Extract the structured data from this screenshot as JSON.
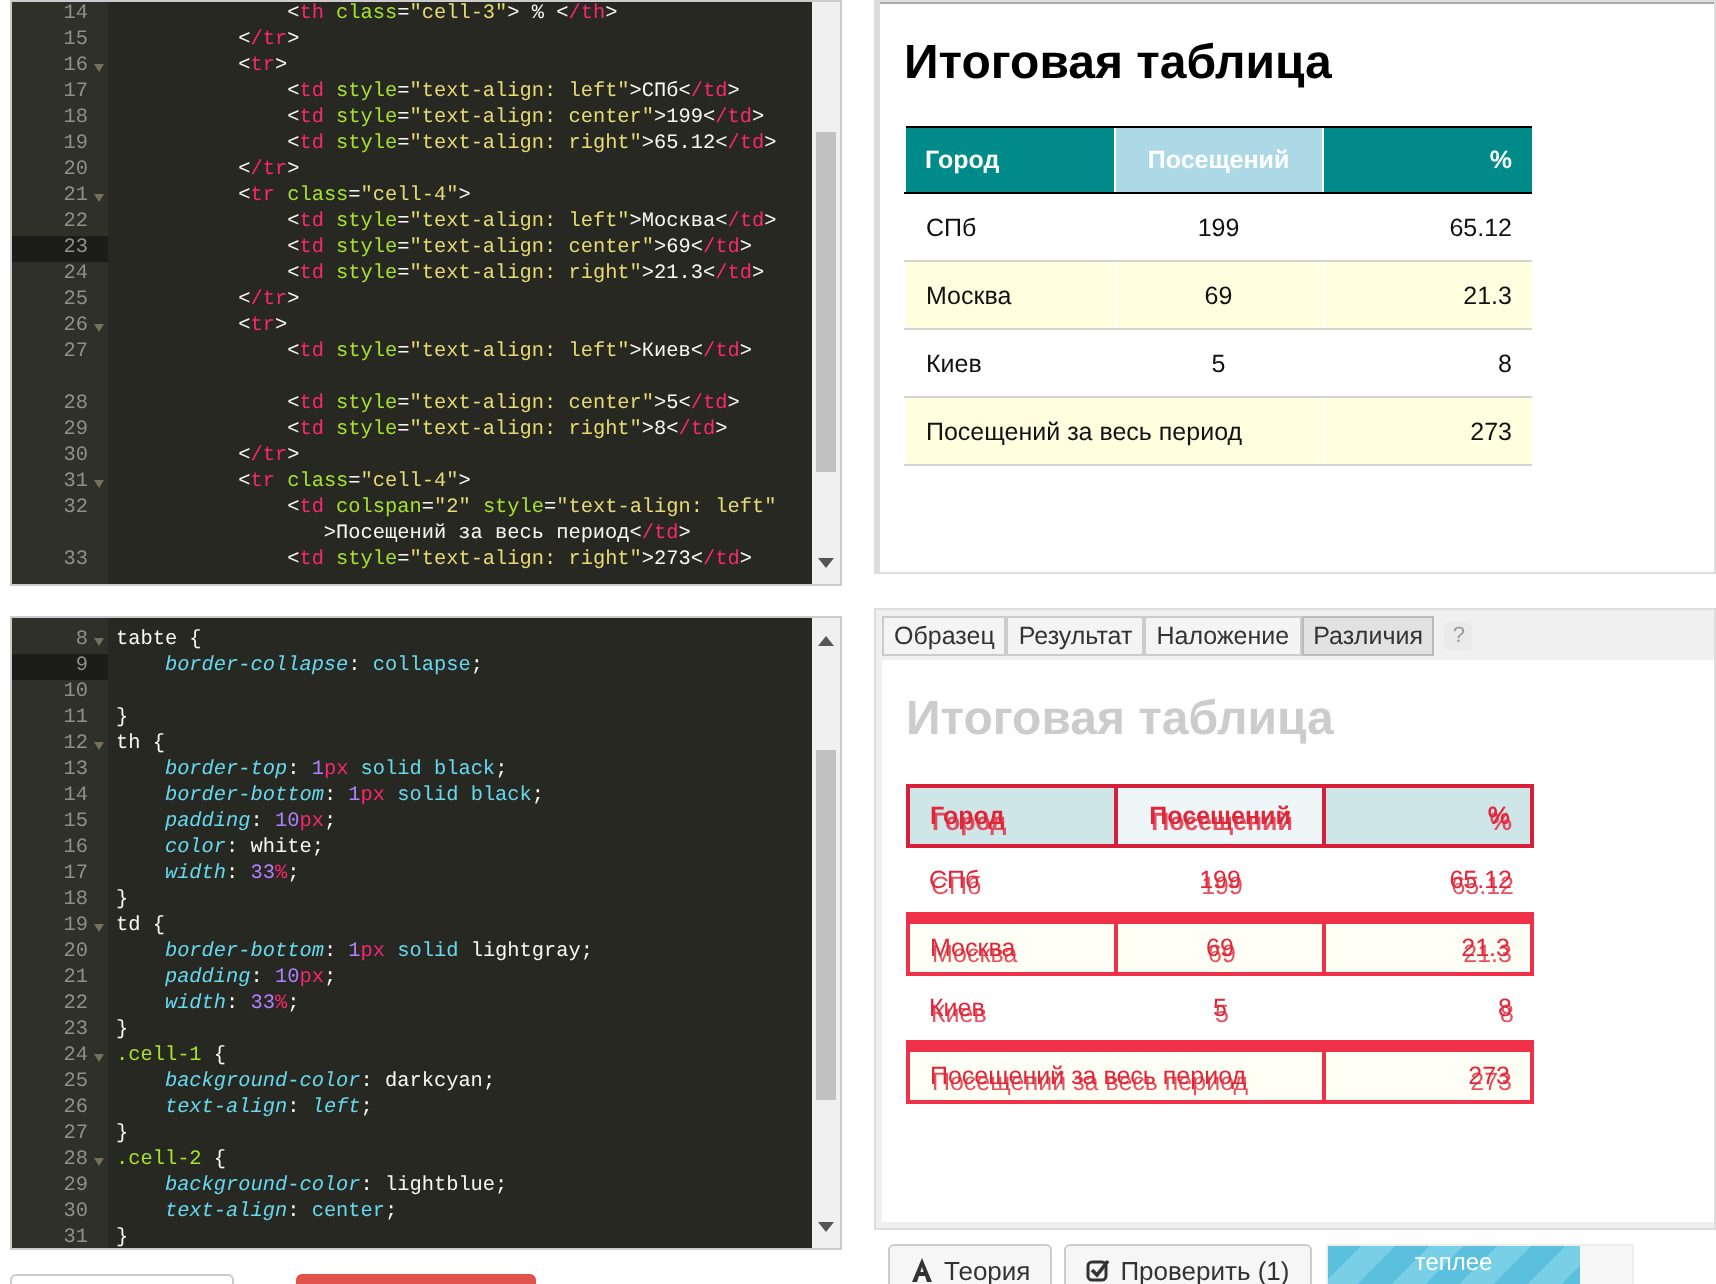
{
  "html_editor": {
    "lines": [
      {
        "number": "14",
        "fold": false,
        "current": false,
        "tokens": [
          {
            "kind": "punct",
            "text": "              <"
          },
          {
            "kind": "tag",
            "text": "th"
          },
          {
            "kind": "attr",
            "text": " class"
          },
          {
            "kind": "punct",
            "text": "="
          },
          {
            "kind": "str",
            "text": "\"cell-3\""
          },
          {
            "kind": "punct",
            "text": "> % <"
          },
          {
            "kind": "tag",
            "text": "/th"
          },
          {
            "kind": "punct",
            "text": ">"
          }
        ]
      },
      {
        "number": "15",
        "fold": false,
        "current": false,
        "tokens": [
          {
            "kind": "punct",
            "text": "          <"
          },
          {
            "kind": "tag",
            "text": "/tr"
          },
          {
            "kind": "punct",
            "text": ">"
          }
        ]
      },
      {
        "number": "16",
        "fold": true,
        "current": false,
        "tokens": [
          {
            "kind": "punct",
            "text": "          <"
          },
          {
            "kind": "tag",
            "text": "tr"
          },
          {
            "kind": "punct",
            "text": ">"
          }
        ]
      },
      {
        "number": "17",
        "fold": false,
        "current": false,
        "tokens": [
          {
            "kind": "punct",
            "text": "              <"
          },
          {
            "kind": "tag",
            "text": "td"
          },
          {
            "kind": "attr",
            "text": " style"
          },
          {
            "kind": "punct",
            "text": "="
          },
          {
            "kind": "str",
            "text": "\"text-align: left\""
          },
          {
            "kind": "punct",
            "text": ">СПб<"
          },
          {
            "kind": "tag",
            "text": "/td"
          },
          {
            "kind": "punct",
            "text": ">"
          }
        ]
      },
      {
        "number": "18",
        "fold": false,
        "current": false,
        "tokens": [
          {
            "kind": "punct",
            "text": "              <"
          },
          {
            "kind": "tag",
            "text": "td"
          },
          {
            "kind": "attr",
            "text": " style"
          },
          {
            "kind": "punct",
            "text": "="
          },
          {
            "kind": "str",
            "text": "\"text-align: center\""
          },
          {
            "kind": "punct",
            "text": ">199<"
          },
          {
            "kind": "tag",
            "text": "/td"
          },
          {
            "kind": "punct",
            "text": ">"
          }
        ]
      },
      {
        "number": "19",
        "fold": false,
        "current": false,
        "tokens": [
          {
            "kind": "punct",
            "text": "              <"
          },
          {
            "kind": "tag",
            "text": "td"
          },
          {
            "kind": "attr",
            "text": " style"
          },
          {
            "kind": "punct",
            "text": "="
          },
          {
            "kind": "str",
            "text": "\"text-align: right\""
          },
          {
            "kind": "punct",
            "text": ">65.12<"
          },
          {
            "kind": "tag",
            "text": "/td"
          },
          {
            "kind": "punct",
            "text": ">"
          }
        ]
      },
      {
        "number": "20",
        "fold": false,
        "current": false,
        "tokens": [
          {
            "kind": "punct",
            "text": "          <"
          },
          {
            "kind": "tag",
            "text": "/tr"
          },
          {
            "kind": "punct",
            "text": ">"
          }
        ]
      },
      {
        "number": "21",
        "fold": true,
        "current": false,
        "tokens": [
          {
            "kind": "punct",
            "text": "          <"
          },
          {
            "kind": "tag",
            "text": "tr"
          },
          {
            "kind": "attr",
            "text": " class"
          },
          {
            "kind": "punct",
            "text": "="
          },
          {
            "kind": "str",
            "text": "\"cell-4\""
          },
          {
            "kind": "punct",
            "text": ">"
          }
        ]
      },
      {
        "number": "22",
        "fold": false,
        "current": false,
        "tokens": [
          {
            "kind": "punct",
            "text": "              <"
          },
          {
            "kind": "tag",
            "text": "td"
          },
          {
            "kind": "attr",
            "text": " style"
          },
          {
            "kind": "punct",
            "text": "="
          },
          {
            "kind": "str",
            "text": "\"text-align: left\""
          },
          {
            "kind": "punct",
            "text": ">Москва<"
          },
          {
            "kind": "tag",
            "text": "/td"
          },
          {
            "kind": "punct",
            "text": ">"
          }
        ]
      },
      {
        "number": "23",
        "fold": false,
        "current": true,
        "tokens": [
          {
            "kind": "punct",
            "text": "              <"
          },
          {
            "kind": "tag",
            "text": "td"
          },
          {
            "kind": "attr",
            "text": " style"
          },
          {
            "kind": "punct",
            "text": "="
          },
          {
            "kind": "str",
            "text": "\"text-align: center\""
          },
          {
            "kind": "punct",
            "text": ">69<"
          },
          {
            "kind": "tag",
            "text": "/td"
          },
          {
            "kind": "punct",
            "text": ">"
          }
        ]
      },
      {
        "number": "24",
        "fold": false,
        "current": false,
        "tokens": [
          {
            "kind": "punct",
            "text": "              <"
          },
          {
            "kind": "tag",
            "text": "td"
          },
          {
            "kind": "attr",
            "text": " style"
          },
          {
            "kind": "punct",
            "text": "="
          },
          {
            "kind": "str",
            "text": "\"text-align: right\""
          },
          {
            "kind": "punct",
            "text": ">21.3<"
          },
          {
            "kind": "tag",
            "text": "/td"
          },
          {
            "kind": "punct",
            "text": ">"
          }
        ]
      },
      {
        "number": "25",
        "fold": false,
        "current": false,
        "tokens": [
          {
            "kind": "punct",
            "text": "          <"
          },
          {
            "kind": "tag",
            "text": "/tr"
          },
          {
            "kind": "punct",
            "text": ">"
          }
        ]
      },
      {
        "number": "26",
        "fold": true,
        "current": false,
        "tokens": [
          {
            "kind": "punct",
            "text": "          <"
          },
          {
            "kind": "tag",
            "text": "tr"
          },
          {
            "kind": "punct",
            "text": ">"
          }
        ]
      },
      {
        "number": "27",
        "fold": false,
        "current": false,
        "wrapped": true,
        "tokens": [
          {
            "kind": "punct",
            "text": "              <"
          },
          {
            "kind": "tag",
            "text": "td"
          },
          {
            "kind": "attr",
            "text": " style"
          },
          {
            "kind": "punct",
            "text": "="
          },
          {
            "kind": "str",
            "text": "\"text-align: left\""
          },
          {
            "kind": "punct",
            "text": ">Киев<"
          },
          {
            "kind": "tag",
            "text": "/td"
          },
          {
            "kind": "punct",
            "text": ">"
          }
        ]
      },
      {
        "number": "28",
        "fold": false,
        "current": false,
        "tokens": [
          {
            "kind": "punct",
            "text": "              <"
          },
          {
            "kind": "tag",
            "text": "td"
          },
          {
            "kind": "attr",
            "text": " style"
          },
          {
            "kind": "punct",
            "text": "="
          },
          {
            "kind": "str",
            "text": "\"text-align: center\""
          },
          {
            "kind": "punct",
            "text": ">5<"
          },
          {
            "kind": "tag",
            "text": "/td"
          },
          {
            "kind": "punct",
            "text": ">"
          }
        ]
      },
      {
        "number": "29",
        "fold": false,
        "current": false,
        "tokens": [
          {
            "kind": "punct",
            "text": "              <"
          },
          {
            "kind": "tag",
            "text": "td"
          },
          {
            "kind": "attr",
            "text": " style"
          },
          {
            "kind": "punct",
            "text": "="
          },
          {
            "kind": "str",
            "text": "\"text-align: right\""
          },
          {
            "kind": "punct",
            "text": ">8<"
          },
          {
            "kind": "tag",
            "text": "/td"
          },
          {
            "kind": "punct",
            "text": ">"
          }
        ]
      },
      {
        "number": "30",
        "fold": false,
        "current": false,
        "tokens": [
          {
            "kind": "punct",
            "text": "          <"
          },
          {
            "kind": "tag",
            "text": "/tr"
          },
          {
            "kind": "punct",
            "text": ">"
          }
        ]
      },
      {
        "number": "31",
        "fold": true,
        "current": false,
        "tokens": [
          {
            "kind": "punct",
            "text": "          <"
          },
          {
            "kind": "tag",
            "text": "tr"
          },
          {
            "kind": "attr",
            "text": " class"
          },
          {
            "kind": "punct",
            "text": "="
          },
          {
            "kind": "str",
            "text": "\"cell-4\""
          },
          {
            "kind": "punct",
            "text": ">"
          }
        ]
      },
      {
        "number": "32",
        "fold": false,
        "current": false,
        "tokens": [
          {
            "kind": "punct",
            "text": "              <"
          },
          {
            "kind": "tag",
            "text": "td"
          },
          {
            "kind": "attr",
            "text": " colspan"
          },
          {
            "kind": "punct",
            "text": "="
          },
          {
            "kind": "str",
            "text": "\"2\""
          },
          {
            "kind": "attr",
            "text": " style"
          },
          {
            "kind": "punct",
            "text": "="
          },
          {
            "kind": "str",
            "text": "\"text-align: left\""
          }
        ],
        "continuation": [
          {
            "kind": "punct",
            "text": "                 >Посещений за весь период<"
          },
          {
            "kind": "tag",
            "text": "/td"
          },
          {
            "kind": "punct",
            "text": ">"
          }
        ]
      },
      {
        "number": "33",
        "fold": false,
        "current": false,
        "tokens": [
          {
            "kind": "punct",
            "text": "              <"
          },
          {
            "kind": "tag",
            "text": "td"
          },
          {
            "kind": "attr",
            "text": " style"
          },
          {
            "kind": "punct",
            "text": "="
          },
          {
            "kind": "str",
            "text": "\"text-align: right\""
          },
          {
            "kind": "punct",
            "text": ">273<"
          },
          {
            "kind": "tag",
            "text": "/td"
          },
          {
            "kind": "punct",
            "text": ">"
          }
        ]
      }
    ]
  },
  "css_editor": {
    "lines": [
      {
        "number": "8",
        "fold": true,
        "current": false,
        "tokens": [
          {
            "kind": "punct",
            "text": "tabte {"
          }
        ]
      },
      {
        "number": "9",
        "fold": false,
        "current": true,
        "tokens": [
          {
            "kind": "prop",
            "text": "    border-collapse"
          },
          {
            "kind": "punct",
            "text": ": "
          },
          {
            "kind": "kw",
            "text": "collapse"
          },
          {
            "kind": "punct",
            "text": ";"
          }
        ]
      },
      {
        "number": "10",
        "fold": false,
        "current": false
      },
      {
        "number": "11",
        "fold": false,
        "current": false,
        "tokens": [
          {
            "kind": "punct",
            "text": "}"
          }
        ]
      },
      {
        "number": "12",
        "fold": true,
        "current": false,
        "tokens": [
          {
            "kind": "punct",
            "text": "th {"
          }
        ]
      },
      {
        "number": "13",
        "fold": false,
        "current": false,
        "tokens": [
          {
            "kind": "prop",
            "text": "    border-top"
          },
          {
            "kind": "punct",
            "text": ": "
          },
          {
            "kind": "num",
            "text": "1"
          },
          {
            "kind": "unit",
            "text": "px"
          },
          {
            "kind": "kw",
            "text": " solid black"
          },
          {
            "kind": "punct",
            "text": ";"
          }
        ]
      },
      {
        "number": "14",
        "fold": false,
        "current": false,
        "tokens": [
          {
            "kind": "prop",
            "text": "    border-bottom"
          },
          {
            "kind": "punct",
            "text": ": "
          },
          {
            "kind": "num",
            "text": "1"
          },
          {
            "kind": "unit",
            "text": "px"
          },
          {
            "kind": "kw",
            "text": " solid black"
          },
          {
            "kind": "punct",
            "text": ";"
          }
        ]
      },
      {
        "number": "15",
        "fold": false,
        "current": false,
        "tokens": [
          {
            "kind": "prop",
            "text": "    padding"
          },
          {
            "kind": "punct",
            "text": ": "
          },
          {
            "kind": "num",
            "text": "10"
          },
          {
            "kind": "unit",
            "text": "px"
          },
          {
            "kind": "punct",
            "text": ";"
          }
        ]
      },
      {
        "number": "16",
        "fold": false,
        "current": false,
        "tokens": [
          {
            "kind": "prop",
            "text": "    color"
          },
          {
            "kind": "punct",
            "text": ": "
          },
          {
            "kind": "val",
            "text": "white"
          },
          {
            "kind": "punct",
            "text": ";"
          }
        ]
      },
      {
        "number": "17",
        "fold": false,
        "current": false,
        "tokens": [
          {
            "kind": "prop",
            "text": "    width"
          },
          {
            "kind": "punct",
            "text": ": "
          },
          {
            "kind": "num",
            "text": "33"
          },
          {
            "kind": "unit",
            "text": "%"
          },
          {
            "kind": "punct",
            "text": ";"
          }
        ]
      },
      {
        "number": "18",
        "fold": false,
        "current": false,
        "tokens": [
          {
            "kind": "punct",
            "text": "}"
          }
        ]
      },
      {
        "number": "19",
        "fold": true,
        "current": false,
        "tokens": [
          {
            "kind": "punct",
            "text": "td {"
          }
        ]
      },
      {
        "number": "20",
        "fold": false,
        "current": false,
        "tokens": [
          {
            "kind": "prop",
            "text": "    border-bottom"
          },
          {
            "kind": "punct",
            "text": ": "
          },
          {
            "kind": "num",
            "text": "1"
          },
          {
            "kind": "unit",
            "text": "px"
          },
          {
            "kind": "kw",
            "text": " solid"
          },
          {
            "kind": "val",
            "text": " lightgray"
          },
          {
            "kind": "punct",
            "text": ";"
          }
        ]
      },
      {
        "number": "21",
        "fold": false,
        "current": false,
        "tokens": [
          {
            "kind": "prop",
            "text": "    padding"
          },
          {
            "kind": "punct",
            "text": ": "
          },
          {
            "kind": "num",
            "text": "10"
          },
          {
            "kind": "unit",
            "text": "px"
          },
          {
            "kind": "punct",
            "text": ";"
          }
        ]
      },
      {
        "number": "22",
        "fold": false,
        "current": false,
        "tokens": [
          {
            "kind": "prop",
            "text": "    width"
          },
          {
            "kind": "punct",
            "text": ": "
          },
          {
            "kind": "num",
            "text": "33"
          },
          {
            "kind": "unit",
            "text": "%"
          },
          {
            "kind": "punct",
            "text": ";"
          }
        ]
      },
      {
        "number": "23",
        "fold": false,
        "current": false,
        "tokens": [
          {
            "kind": "punct",
            "text": "}"
          }
        ]
      },
      {
        "number": "24",
        "fold": true,
        "current": false,
        "tokens": [
          {
            "kind": "cls",
            "text": ".cell-1"
          },
          {
            "kind": "punct",
            "text": " {"
          }
        ]
      },
      {
        "number": "25",
        "fold": false,
        "current": false,
        "tokens": [
          {
            "kind": "prop",
            "text": "    background-color"
          },
          {
            "kind": "punct",
            "text": ": "
          },
          {
            "kind": "val",
            "text": "darkcyan"
          },
          {
            "kind": "punct",
            "text": ";"
          }
        ]
      },
      {
        "number": "26",
        "fold": false,
        "current": false,
        "tokens": [
          {
            "kind": "prop",
            "text": "    text-align"
          },
          {
            "kind": "punct",
            "text": ": "
          },
          {
            "kind": "kwi",
            "text": "left"
          },
          {
            "kind": "punct",
            "text": ";"
          }
        ]
      },
      {
        "number": "27",
        "fold": false,
        "current": false,
        "tokens": [
          {
            "kind": "punct",
            "text": "}"
          }
        ]
      },
      {
        "number": "28",
        "fold": true,
        "current": false,
        "tokens": [
          {
            "kind": "cls",
            "text": ".cell-2"
          },
          {
            "kind": "punct",
            "text": " {"
          }
        ]
      },
      {
        "number": "29",
        "fold": false,
        "current": false,
        "tokens": [
          {
            "kind": "prop",
            "text": "    background-color"
          },
          {
            "kind": "punct",
            "text": ": "
          },
          {
            "kind": "val",
            "text": "lightblue"
          },
          {
            "kind": "punct",
            "text": ";"
          }
        ]
      },
      {
        "number": "30",
        "fold": false,
        "current": false,
        "tokens": [
          {
            "kind": "prop",
            "text": "    text-align"
          },
          {
            "kind": "punct",
            "text": ": "
          },
          {
            "kind": "kw",
            "text": "center"
          },
          {
            "kind": "punct",
            "text": ";"
          }
        ]
      },
      {
        "number": "31",
        "fold": false,
        "current": false,
        "tokens": [
          {
            "kind": "punct",
            "text": "}"
          }
        ]
      }
    ]
  },
  "preview": {
    "title": "Итоговая таблица",
    "header": [
      {
        "text": "Город",
        "color": "#008b8b"
      },
      {
        "text": "Посещений",
        "color": "#add8e6"
      },
      {
        "text": "%",
        "color": "#008b8b"
      }
    ],
    "rows": [
      {
        "kind": "data",
        "highlight": false,
        "cells": [
          {
            "text": "СПб"
          },
          {
            "text": "199"
          },
          {
            "text": "65.12"
          }
        ]
      },
      {
        "kind": "data",
        "highlight": true,
        "cells": [
          {
            "text": "Москва"
          },
          {
            "text": "69"
          },
          {
            "text": "21.3"
          }
        ]
      },
      {
        "kind": "data",
        "highlight": false,
        "cells": [
          {
            "text": "Киев"
          },
          {
            "text": "5"
          },
          {
            "text": "8"
          }
        ]
      },
      {
        "kind": "summary",
        "highlight": true,
        "cells": [
          {
            "text": "Посещений за весь период",
            "colspan": 2
          },
          {
            "text": "273"
          }
        ]
      }
    ]
  },
  "compare": {
    "tabs": [
      {
        "label": "Образец",
        "selected": false
      },
      {
        "label": "Результат",
        "selected": false
      },
      {
        "label": "Наложение",
        "selected": false
      },
      {
        "label": "Различия",
        "selected": true
      }
    ],
    "help": "?",
    "title": "Итоговая таблица",
    "header_changed": true,
    "header": [
      {
        "text": "Город",
        "color": "#cfe6e8"
      },
      {
        "text": "Посещений",
        "color": "#eef6f8"
      },
      {
        "text": "%",
        "color": "#cfe6e8"
      }
    ],
    "rows": [
      {
        "kind": "data",
        "changed": false,
        "cells": [
          {
            "text": "СПб"
          },
          {
            "text": "199"
          },
          {
            "text": "65.12"
          }
        ]
      },
      {
        "kind": "data",
        "changed": true,
        "cells": [
          {
            "text": "Москва"
          },
          {
            "text": "69"
          },
          {
            "text": "21.3"
          }
        ]
      },
      {
        "kind": "data",
        "changed": false,
        "cells": [
          {
            "text": "Киев"
          },
          {
            "text": "5"
          },
          {
            "text": "8"
          }
        ]
      },
      {
        "kind": "summary",
        "changed": true,
        "cells": [
          {
            "text": "Посещений за весь период",
            "colspan": 2
          },
          {
            "text": "273"
          }
        ]
      }
    ]
  },
  "actions": {
    "theory": "Теория",
    "check": "Проверить (1)",
    "progress": {
      "label": "теплее",
      "level": 0.83
    }
  }
}
